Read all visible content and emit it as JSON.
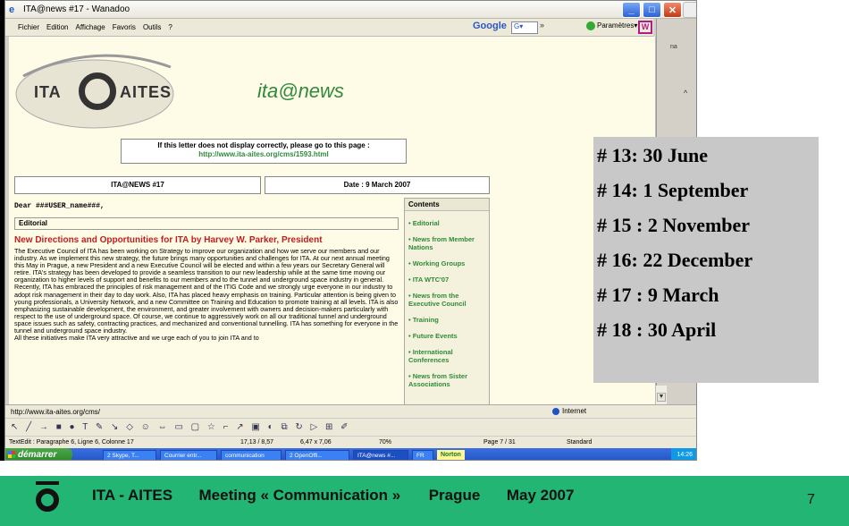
{
  "window": {
    "title": "ITA@news #17 - Wanadoo",
    "menu": [
      "Fichier",
      "Edition",
      "Affichage",
      "Favoris",
      "Outils",
      "?"
    ],
    "google_label": "Google",
    "google_box": "G▾",
    "toolbar_more": "»",
    "params_label": "Paramètres▾",
    "w_button": "W"
  },
  "newsletter": {
    "logo_left": "ITA",
    "logo_right": "AITES",
    "title": "ita@news",
    "notice_line1": "If this letter does not display correctly, please go to this page :",
    "notice_url": "http://www.ita-aites.org/cms/1593.html",
    "issue_label": "ITA@NEWS #17",
    "date_label": "Date : 9 March 2007",
    "greeting": "Dear ###USER_name###,",
    "section": "Editorial",
    "headline": "New Directions and Opportunities for ITA by Harvey W. Parker, President",
    "body": "The Executive Council of ITA has been working on Strategy to improve our organization and how we serve our members and our industry.  As we implement this new strategy, the future brings many opportunities and challenges for ITA.  At our next annual meeting this May in Prague, a new President and a new Executive Council will be elected and within a few years our Secretary General will retire.  ITA's strategy has been developed to provide a seamless transition to our new leadership while at the same time moving our organization to higher levels of support and benefits to our members and to the tunnel and underground space industry in general.\nRecently, ITA has embraced the principles of risk management and of the ITIG Code and we strongly urge everyone in our industry to adopt risk management in their day to day work. Also, ITA has placed heavy emphasis on training.  Particular attention is being given to young professionals, a University Network, and a new Committee on Training and Education to promote training at all levels.  ITA is also emphasizing sustainable development, the environment, and greater involvement with owners and decision-makers particularly with respect to the use of underground space.  Of course, we continue to aggressively work on all our traditional tunnel and underground space issues such as safety, contracting practices, and mechanized and conventional tunnelling.  ITA has something for everyone in the tunnel and underground space industry.\nAll these initiatives make ITA very attractive and we urge each of you to join ITA and to",
    "contents_title": "Contents",
    "contents": [
      "Editorial",
      "News from Member Nations",
      "Working Groups",
      "ITA WTC'07",
      "News from the Executive Council",
      "Training",
      "Future Events",
      "International Conferences",
      "News from Sister Associations"
    ]
  },
  "right_pane": {
    "text": "na",
    "arrow": "^"
  },
  "status": {
    "url": "http://www.ita-aites.org/cms/",
    "zone": "Internet"
  },
  "info_bar": {
    "paragraph": "TextEdit : Paragraphe 6, Ligne 6, Colonne 17",
    "position": "17,13 / 8,57",
    "size": "6,47 x 7,06",
    "zoom": "70%",
    "page": "Page 7 / 31",
    "style": "Standard"
  },
  "taskbar": {
    "start": "démarrer",
    "items": [
      "2 Skype, T...",
      "Courrier entr...",
      "communication",
      "2 OpenOffi...",
      "ITA@news #..."
    ],
    "lang": "FR",
    "norton": "Norton",
    "clock": "14:26"
  },
  "schedule": [
    "# 13: 30 June",
    "# 14: 1 September",
    "# 15 : 2 November",
    "# 16: 22 December",
    "# 17 : 9 March",
    "# 18 : 30 April"
  ],
  "footer": {
    "org": "ITA - AITES",
    "meeting": "Meeting « Communication »",
    "city": "Prague",
    "date": "May 2007",
    "page_number": "7"
  }
}
